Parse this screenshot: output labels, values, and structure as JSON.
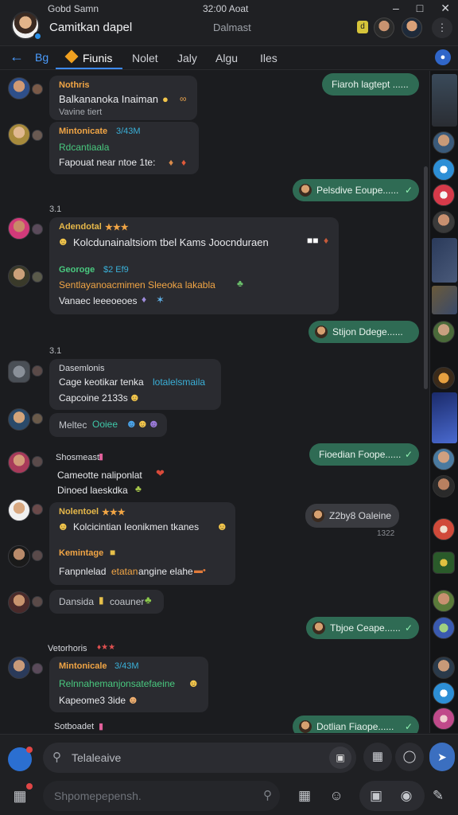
{
  "window": {
    "top_left_label": "Gobd Samn",
    "clock": "32:00 Aoat",
    "controls": [
      "–",
      "□",
      "✕"
    ]
  },
  "header": {
    "title": "Camitkan dapel",
    "status": "Dalmast",
    "badge": "d"
  },
  "tabs": {
    "tab0": "Bg",
    "items": [
      "Fiunis",
      "Nolet",
      "Jaly",
      "Algu",
      "Iles"
    ],
    "active": 0
  },
  "messages": {
    "m1": {
      "name": "Nothris",
      "text": "Balkananoka Inaiman",
      "sub": "Vavine tiert"
    },
    "m2": {
      "name": "Mintonicate",
      "tag": "3/43M",
      "line1": "Rdcantiaala",
      "text": "Fapouat near ntoe 1te:"
    },
    "o1": "Fiaroh lagtept ......",
    "o2": "Pelsdive Eoupe......",
    "sep1": "3.1",
    "m3": {
      "name": "Adendotal",
      "stars": "★★★",
      "text": "Kolcdunainaltsiom tbel Kams Joocnduraen"
    },
    "m4": {
      "name": "Georoge",
      "tag": "$2 Ef9",
      "line1": "Sentlayanoacmimen Sleeoka lakabla",
      "text": "Vanaec leeeoeoes"
    },
    "o3": "Stijon Ddege......",
    "sep2": "3.1",
    "m5": {
      "name": "Dasemlonis",
      "text_a": "Cage keotikar tenka",
      "text_b": "lotalelsmaila",
      "text_c": "Capcoine 2133s"
    },
    "m6": {
      "text_a": "Meltec",
      "text_b": "Ooiee"
    },
    "o4": "Fioedian Foope......",
    "m7": {
      "name": "Shosmeast",
      "line1": "Cameotte naliponlat",
      "text": "Dinoed laeskdka"
    },
    "m8": {
      "name": "Nolentoel",
      "stars": "★★★",
      "text": "Kolcicintian Ieonikmen tkanes"
    },
    "o5": "Z2by8 Oaleine",
    "o5_time": "1322",
    "m9": {
      "name": "Kemintage",
      "text_a": "Fanpnlelad",
      "text_b": "etatan",
      "text_c": "angine elahe"
    },
    "m10": {
      "text_a": "Dansida",
      "text_b": "coauner"
    },
    "o6": "Tbjoe Ceape......",
    "m11_header": "Vetorhoris",
    "m11": {
      "name": "Mintonicale",
      "tag": "3/43M",
      "line1": "Relnnahemanjonsatefaeine",
      "text": "Kapeome3 3ide"
    },
    "m12_header": "Sotboadet",
    "o7": "Dotlian Fiaope......"
  },
  "composer": {
    "search_placeholder": "Telaleaive",
    "secondary_placeholder": "Shpomepepensh."
  },
  "icons": {
    "back": "arrow-left-icon",
    "send": "send-icon",
    "search": "search-icon"
  },
  "colors": {
    "accent": "#3d8bff",
    "outgoing": "#2f6b54",
    "name_orange": "#f1a545",
    "name_green": "#49c97f"
  }
}
